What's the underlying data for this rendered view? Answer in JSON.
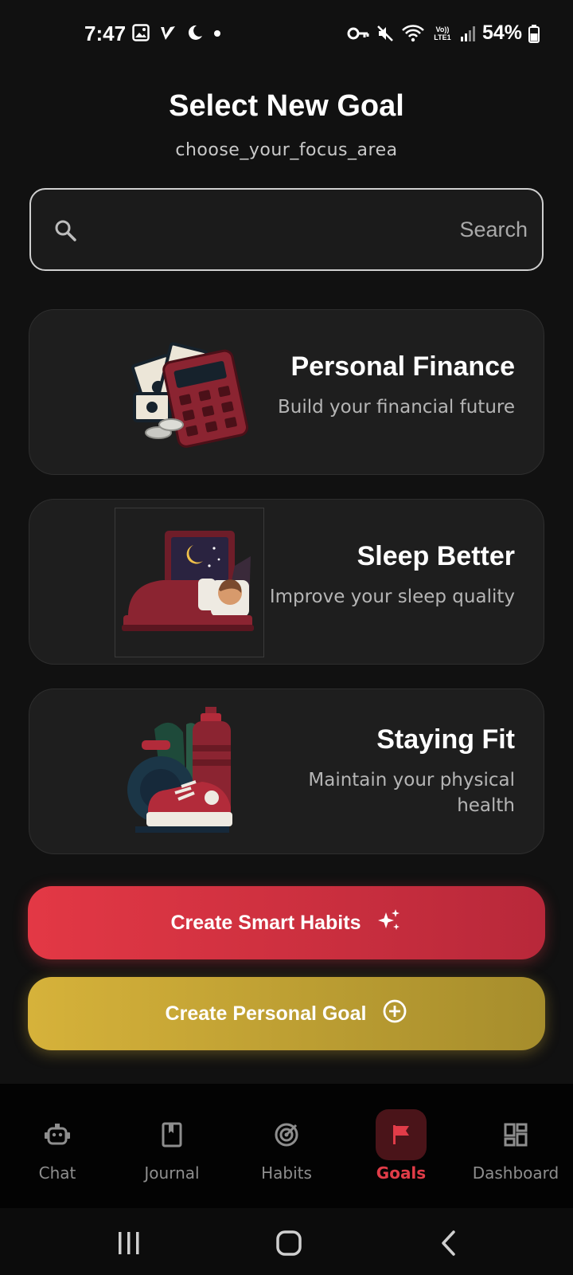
{
  "status_bar": {
    "time": "7:47",
    "battery": "54%",
    "network": "Vo)) LTE1"
  },
  "header": {
    "title": "Select New Goal",
    "subtitle": "choose_your_focus_area"
  },
  "search": {
    "placeholder": "Search",
    "value": "",
    "icon": "search-icon"
  },
  "goals": [
    {
      "title": "Personal Finance",
      "description": "Build your financial future",
      "icon": "calculator-money-illustration"
    },
    {
      "title": "Sleep Better",
      "description": "Improve your sleep quality",
      "icon": "sleeping-person-illustration"
    },
    {
      "title": "Staying Fit",
      "description": "Maintain your physical health",
      "icon": "fitness-gear-illustration"
    }
  ],
  "actions": {
    "smart_habits": "Create Smart Habits",
    "personal_goal": "Create Personal Goal"
  },
  "nav": {
    "items": [
      {
        "label": "Chat",
        "icon": "robot-icon"
      },
      {
        "label": "Journal",
        "icon": "book-icon"
      },
      {
        "label": "Habits",
        "icon": "target-icon"
      },
      {
        "label": "Goals",
        "icon": "flag-icon"
      },
      {
        "label": "Dashboard",
        "icon": "dashboard-icon"
      }
    ],
    "active": "Goals"
  },
  "colors": {
    "accent_red": "#e33845",
    "accent_gold": "#d6b23a",
    "background": "#111111",
    "card": "#1e1e1e",
    "nav_active": "#e13c48"
  }
}
